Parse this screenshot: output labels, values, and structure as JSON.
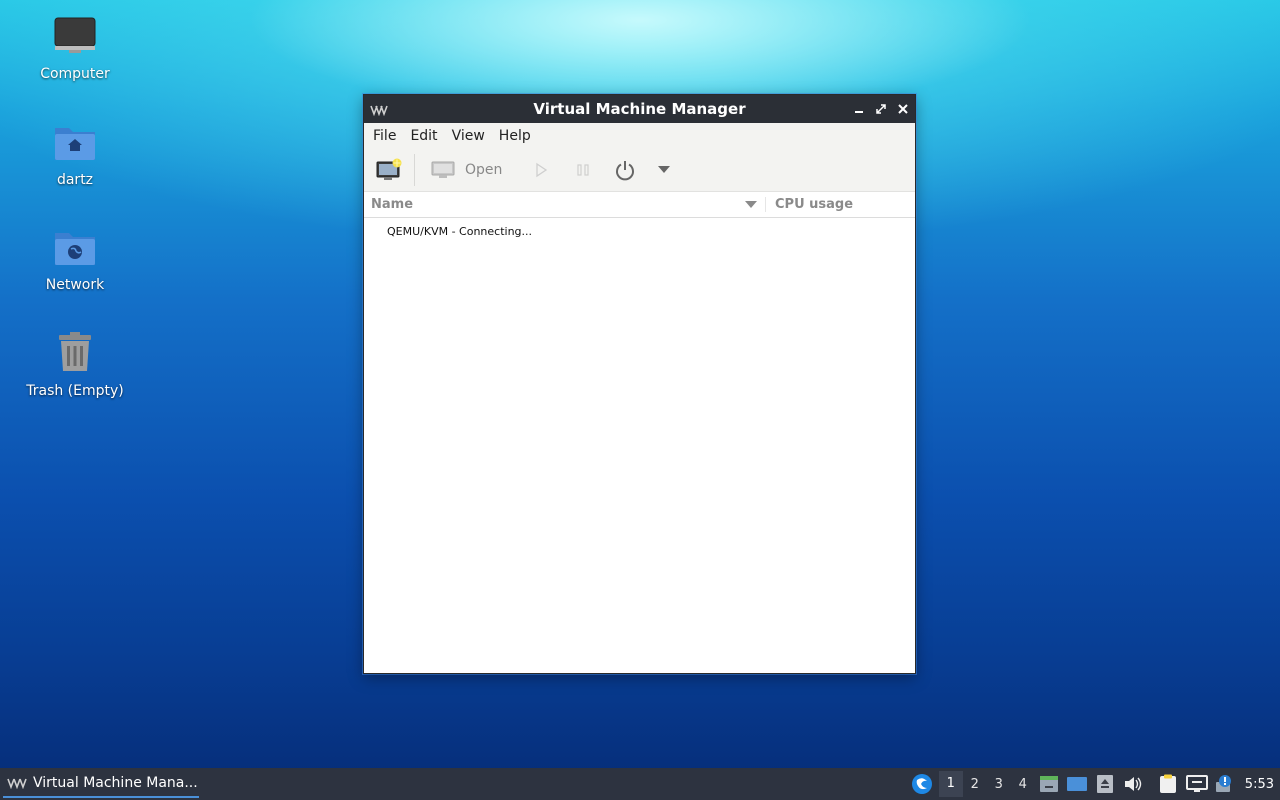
{
  "desktop": {
    "icons": [
      {
        "label": "Computer",
        "icon": "computer-icon"
      },
      {
        "label": "dartz",
        "icon": "home-folder-icon"
      },
      {
        "label": "Network",
        "icon": "network-folder-icon"
      },
      {
        "label": "Trash (Empty)",
        "icon": "trash-icon"
      }
    ]
  },
  "window": {
    "title": "Virtual Machine Manager",
    "menu": [
      "File",
      "Edit",
      "View",
      "Help"
    ],
    "toolbar": {
      "open_label": "Open"
    },
    "columns": {
      "name": "Name",
      "cpu": "CPU usage"
    },
    "rows": [
      {
        "name": "QEMU/KVM - Connecting..."
      }
    ]
  },
  "taskbar": {
    "task_label": "Virtual Machine Mana...",
    "workspaces": [
      "1",
      "2",
      "3",
      "4"
    ],
    "active_workspace": "1",
    "clock": "5:53"
  },
  "colors": {
    "titlebar": "#2b2f36",
    "taskbar": "#2d3340",
    "accent": "#4a90d9"
  }
}
